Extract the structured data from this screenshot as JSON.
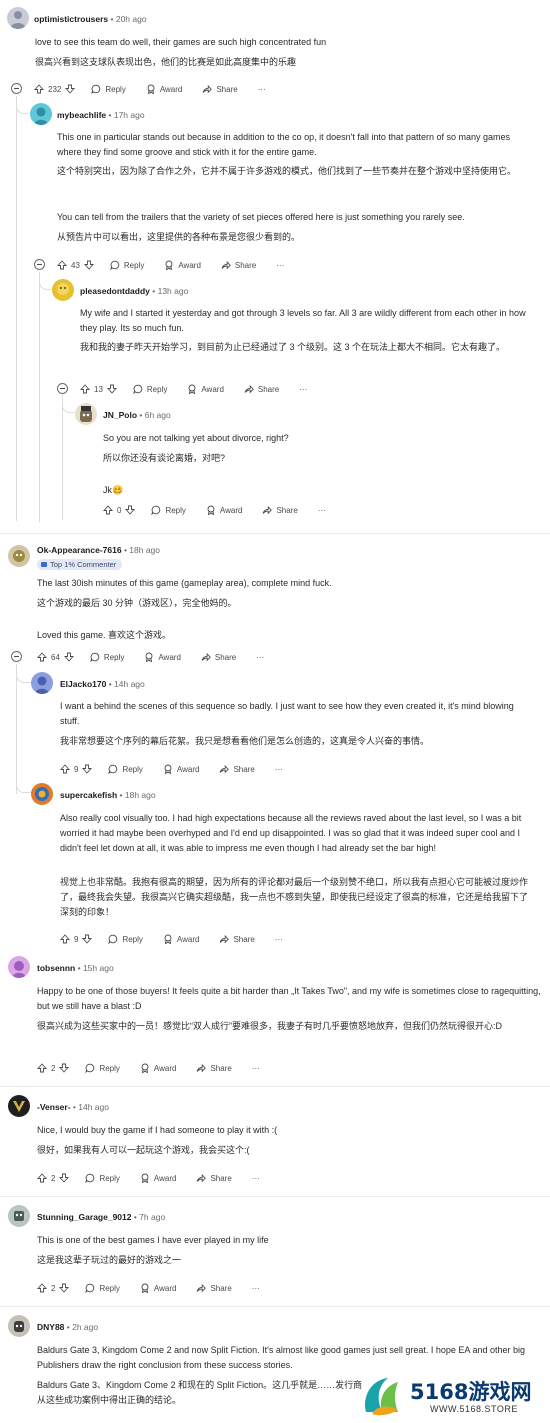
{
  "comments": [
    {
      "user": "optimistictrousers",
      "age": " • 20h ago",
      "en": "love to see this team do well, their games are such high concentrated fun",
      "zh": "很高兴看到这支球队表现出色，他们的比赛是如此高度集中的乐趣",
      "votes": "232"
    },
    {
      "user": "mybeachlife",
      "age": " • 17h ago",
      "en": "This one in particular stands out because in addition to the co op, it doesn't fall into that pattern of so many games where they find some groove and stick with it for the entire game.",
      "zh": "这个特别突出，因为除了合作之外，它并不属于许多游戏的模式，他们找到了一些节奏并在整个游戏中坚持使用它。",
      "en2": "You can tell from the trailers that the variety of set pieces offered here is just something you rarely see.",
      "zh2": "从预告片中可以看出，这里提供的各种布景是您很少看到的。",
      "votes": "43"
    },
    {
      "user": "pleasedontdaddy",
      "age": " • 13h ago",
      "en": "My wife and I started it yesterday and got through 3 levels so far. All 3 are wildly different from each other in how they play. Its so much fun.",
      "zh": "我和我的妻子昨天开始学习，到目前为止已经通过了 3 个级别。这 3 个在玩法上都大不相同。它太有趣了。",
      "votes": "13"
    },
    {
      "user": "JN_Polo",
      "age": " • 6h ago",
      "en": "So you are not talking yet about divorce, right?",
      "zh": "所以你还没有谈论离婚，对吧?",
      "en2": "Jk🥴",
      "votes": "0"
    },
    {
      "user": "Ok-Appearance-7616",
      "age": " • 18h ago",
      "badge": "Top 1% Commenter",
      "en": "The last 30ish minutes of this game (gameplay area), complete mind fuck.",
      "zh": "这个游戏的最后 30 分钟（游戏区），完全他妈的。",
      "en2": "Loved this game.   喜欢这个游戏。",
      "votes": "64"
    },
    {
      "user": "ElJacko170",
      "age": " • 14h ago",
      "en": "I want a behind the scenes of this sequence so badly. I just want to see how they even created it, it's mind blowing stuff.",
      "zh": "我非常想要这个序列的幕后花絮。我只是想看看他们是怎么创造的，这真是令人兴奋的事情。",
      "votes": "9"
    },
    {
      "user": "supercakefish",
      "age": " • 18h ago",
      "en": "Also really cool visually too. I had high expectations because all the reviews raved about the last level, so I was a bit worried it had maybe been overhyped and I'd end up disappointed. I was so glad that it was indeed super cool and I didn't feel let down at all, it was able to impress me even though I had already set the bar high!",
      "zh": "视觉上也非常酷。我抱有很高的期望，因为所有的评论都对最后一个级别赞不绝口，所以我有点担心它可能被过度炒作了，最终我会失望。我很高兴它确实超级酷，我一点也不感到失望，即使我已经设定了很高的标准，它还是给我留下了深刻的印象！",
      "votes": "9"
    },
    {
      "user": "tobsennn",
      "age": " • 15h ago",
      "en": "Happy to be one of those buyers! It feels quite a bit harder than „It Takes Two\", and my wife is sometimes close to ragequitting, but we still have a blast :D",
      "zh": "很高兴成为这些买家中的一员！感觉比“双人成行”要难很多，我妻子有时几乎要愤怒地放弃，但我们仍然玩得很开心:D",
      "votes": "2"
    },
    {
      "user": "-Venser-",
      "age": " • 14h ago",
      "en": "Nice, I would buy the game if I had someone to play it with :(",
      "zh": "很好，如果我有人可以一起玩这个游戏，我会买这个:(",
      "votes": "2"
    },
    {
      "user": "Stunning_Garage_9012",
      "age": " • 7h ago",
      "en": "This is one of the best games I have ever played in my life",
      "zh": "这是我这辈子玩过的最好的游戏之一",
      "votes": "2"
    },
    {
      "user": "DNY88",
      "age": " • 2h ago",
      "en": "Baldurs Gate 3, Kingdom Come 2 and now Split Fiction. It's almost like good games just sell great. I hope EA and other big Publishers draw the right conclusion from these success stories.",
      "zh": "Baldurs Gate 3、Kingdom Come 2 和现在的 Split Fiction。这几乎就是……发行商从这些成功案例中得出正确的结论。"
    }
  ],
  "actions": {
    "reply": "Reply",
    "award": "Award",
    "share": "Share",
    "more": "···"
  },
  "watermark": {
    "name": "5168游戏网",
    "url": "WWW.5168.STORE"
  }
}
